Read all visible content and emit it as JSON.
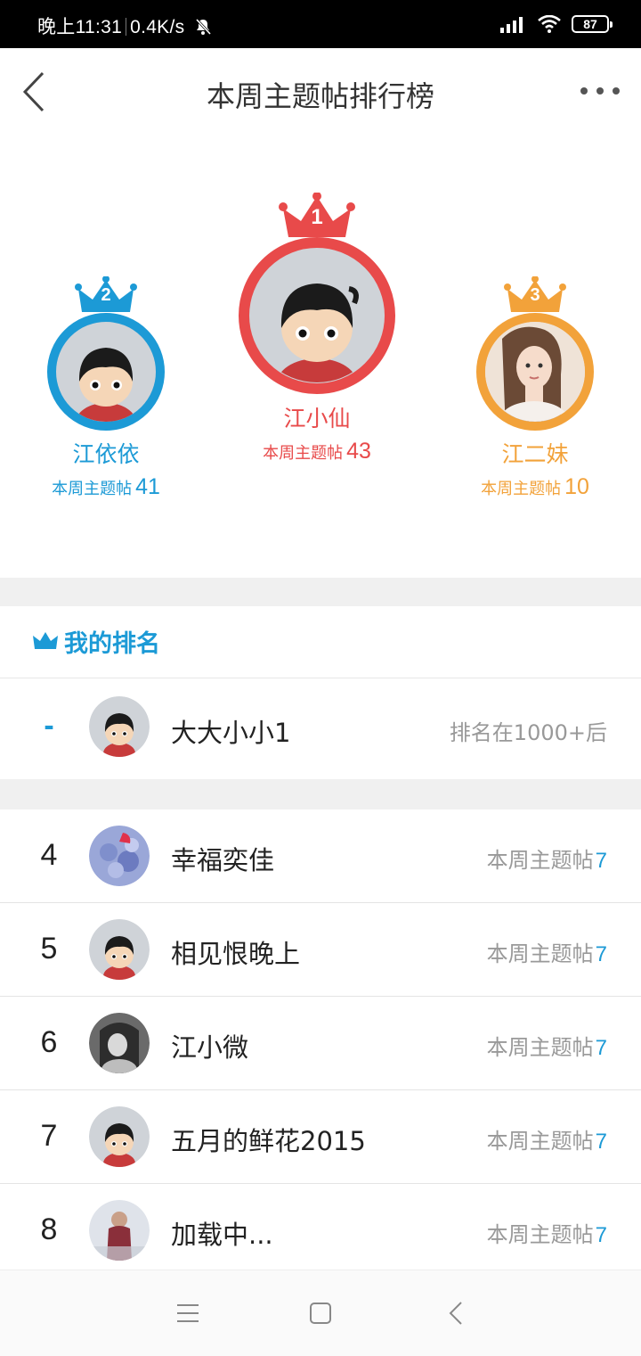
{
  "status_bar": {
    "time": "晚上11:31",
    "network_speed": "0.4K/s",
    "battery": "87"
  },
  "header": {
    "title": "本周主题帖排行榜"
  },
  "podium": [
    {
      "rank": "1",
      "name": "江小仙",
      "count_label": "本周主题帖",
      "count": "43",
      "color": "#e84a4a"
    },
    {
      "rank": "2",
      "name": "江依依",
      "count_label": "本周主题帖",
      "count": "41",
      "color": "#1c9ad6"
    },
    {
      "rank": "3",
      "name": "江二妹",
      "count_label": "本周主题帖",
      "count": "10",
      "color": "#f2a23a"
    }
  ],
  "my_ranking": {
    "title": "我的排名",
    "rank": "-",
    "name": "大大小小1",
    "status": "排名在1000+后"
  },
  "list": [
    {
      "rank": "4",
      "name": "幸福奕佳",
      "count_label": "本周主题帖",
      "count": "7"
    },
    {
      "rank": "5",
      "name": "相见恨晚上",
      "count_label": "本周主题帖",
      "count": "7"
    },
    {
      "rank": "6",
      "name": "江小微",
      "count_label": "本周主题帖",
      "count": "7"
    },
    {
      "rank": "7",
      "name": "五月的鲜花2015",
      "count_label": "本周主题帖",
      "count": "7"
    },
    {
      "rank": "8",
      "name": "加载中...",
      "count_label": "本周主题帖",
      "count": "7"
    }
  ],
  "colors": {
    "accent_blue": "#1c9ad6",
    "first_red": "#e84a4a",
    "third_orange": "#f2a23a"
  }
}
